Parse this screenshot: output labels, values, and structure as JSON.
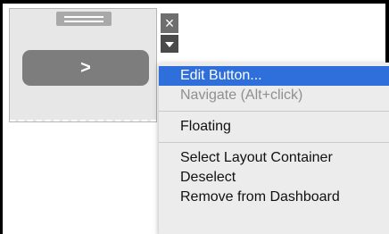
{
  "object": {
    "button_glyph": ">"
  },
  "controls": {
    "close_glyph": "×"
  },
  "context_menu": {
    "items": [
      {
        "label": "Edit Button...",
        "state": "highlighted"
      },
      {
        "label": "Navigate (Alt+click)",
        "state": "disabled"
      },
      {
        "label": "Floating",
        "state": "normal"
      },
      {
        "label": "Select Layout Container",
        "state": "normal"
      },
      {
        "label": "Deselect",
        "state": "normal"
      },
      {
        "label": "Remove from Dashboard",
        "state": "normal"
      }
    ]
  },
  "colors": {
    "highlight": "#2f6fdc",
    "button_fill": "#7d7d7d",
    "object_fill": "#e7e7e7"
  }
}
